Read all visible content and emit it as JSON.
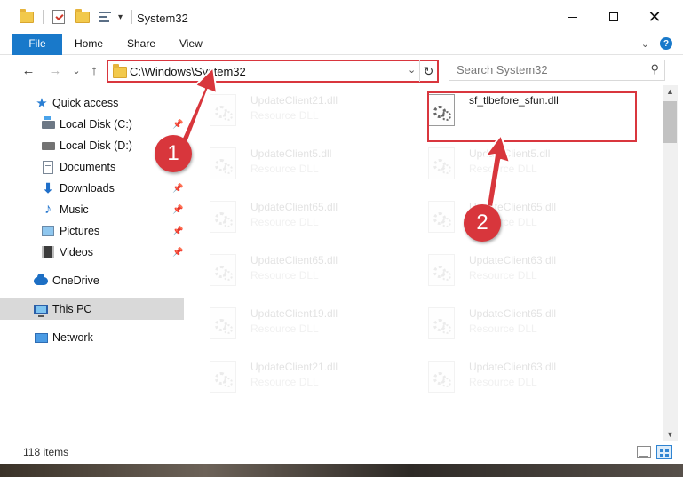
{
  "window": {
    "title": "System32",
    "minimize_glyph": "—",
    "close_glyph": "✕"
  },
  "ribbon": {
    "tabs": [
      {
        "label": "File",
        "active": true
      },
      {
        "label": "Home"
      },
      {
        "label": "Share"
      },
      {
        "label": "View"
      }
    ],
    "help_glyph": "?"
  },
  "nav": {
    "back_glyph": "←",
    "forward_glyph": "→",
    "recent_glyph": "⌄",
    "up_glyph": "↑"
  },
  "address": {
    "path": "C:\\Windows\\System32",
    "dropdown_glyph": "⌄",
    "refresh_glyph": "↻"
  },
  "search": {
    "placeholder": "Search System32",
    "icon": "⚲"
  },
  "sidebar": {
    "items": [
      {
        "label": "Quick access",
        "icon": "star-icon",
        "pinned": false
      },
      {
        "label": "Local Disk (C:)",
        "icon": "drive-c-icon",
        "pinned": true
      },
      {
        "label": "Local Disk (D:)",
        "icon": "drive-d-icon",
        "pinned": false
      },
      {
        "label": "Documents",
        "icon": "documents-icon",
        "pinned": true
      },
      {
        "label": "Downloads",
        "icon": "downloads-icon",
        "pinned": true
      },
      {
        "label": "Music",
        "icon": "music-icon",
        "pinned": true
      },
      {
        "label": "Pictures",
        "icon": "pictures-icon",
        "pinned": true
      },
      {
        "label": "Videos",
        "icon": "videos-icon",
        "pinned": true
      },
      {
        "label": "OneDrive",
        "icon": "onedrive-icon",
        "pinned": false
      },
      {
        "label": "This PC",
        "icon": "this-pc-icon",
        "pinned": false,
        "selected": true
      },
      {
        "label": "Network",
        "icon": "network-icon",
        "pinned": false
      }
    ],
    "pin_glyph": "📌"
  },
  "files": {
    "left_column": [
      {
        "name": "UpdateClient21.dll",
        "type": "Resource DLL"
      },
      {
        "name": "UpdateClient5.dll",
        "type": "Resource DLL"
      },
      {
        "name": "UpdateClient65.dll",
        "type": "Resource DLL"
      },
      {
        "name": "UpdateClient65.dll",
        "type": "Resource DLL"
      },
      {
        "name": "UpdateClient19.dll",
        "type": "Resource DLL"
      },
      {
        "name": "UpdateClient21.dll",
        "type": "Resource DLL"
      }
    ],
    "right_column": [
      {
        "name": "sf_tlbefore_sfun.dll",
        "type": "",
        "highlighted": true
      },
      {
        "name": "UpdateClient5.dll",
        "type": "Resource DLL"
      },
      {
        "name": "UpdateClient65.dll",
        "type": "Resource DLL"
      },
      {
        "name": "UpdateClient63.dll",
        "type": "Resource DLL"
      },
      {
        "name": "UpdateClient65.dll",
        "type": "Resource DLL"
      },
      {
        "name": "UpdateClient63.dll",
        "type": "Resource DLL"
      }
    ]
  },
  "scrollbar": {
    "up_glyph": "▲",
    "down_glyph": "▼"
  },
  "status": {
    "item_count": "118 items"
  },
  "annotations": {
    "callout_1": "1",
    "callout_2": "2",
    "accent_color": "#d8363c"
  }
}
